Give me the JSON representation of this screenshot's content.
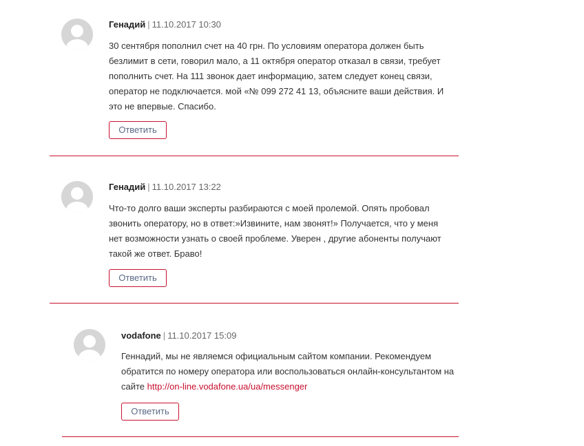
{
  "comments": [
    {
      "author": "Генадий",
      "date": "11.10.2017 10:30",
      "separator": "|",
      "text": "30 сентября пополнил счет на 40 грн. По условиям оператора должен быть безлимит в сети, говорил мало, а 11 октября оператор отказал в связи, требует пополнить счет. На 111 звонок дает информацию, затем следует конец связи, оператор не подключается. мой «№ 099 272 41 13, объясните ваши действия. И это не впервые. Спасибо.",
      "reply_label": "Ответить"
    },
    {
      "author": "Генадий",
      "date": "11.10.2017 13:22",
      "separator": "|",
      "text": "Что-то долго ваши эксперты разбираются с моей пролемой. Опять пробовал звонить оператору, но в ответ:»Извините, нам звонят!» Получается, что у меня нет возможности узнать о своей проблеме. Уверен , другие абоненты получают такой же ответ. Браво!",
      "reply_label": "Ответить"
    },
    {
      "author": "vodafone",
      "date": "11.10.2017 15:09",
      "separator": "|",
      "text": "Геннадий, мы не являемся официальным сайтом компании. Рекомендуем обратится по номеру оператора или воспользоваться онлайн-консультантом на сайте ",
      "link": "http://on-line.vodafone.ua/ua/messenger",
      "reply_label": "Ответить"
    }
  ],
  "colors": {
    "accent": "#c8102e",
    "button_text": "#5b6a86",
    "avatar": "#d6d6d6"
  },
  "icons": {
    "avatar": "user-silhouette-icon"
  }
}
